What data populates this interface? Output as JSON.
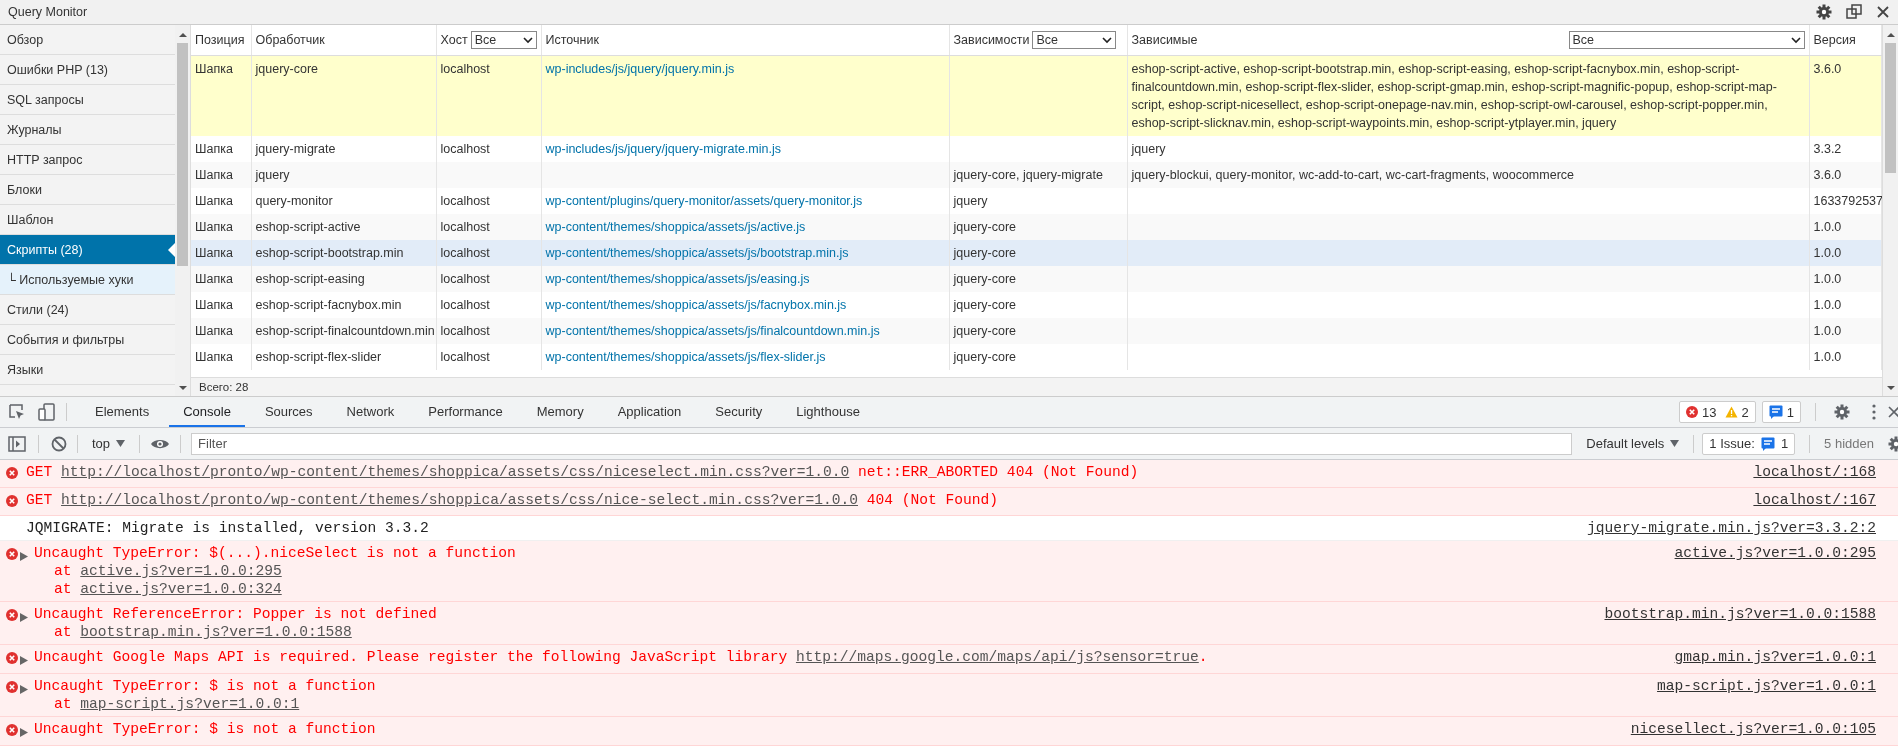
{
  "query_monitor": {
    "title": "Query Monitor",
    "sidebar": {
      "items": [
        {
          "label": "Обзор",
          "selected": false
        },
        {
          "label": "Ошибки PHP (13)",
          "selected": false
        },
        {
          "label": "SQL запросы",
          "selected": false
        },
        {
          "label": "Журналы",
          "selected": false
        },
        {
          "label": "HTTP запрос",
          "selected": false
        },
        {
          "label": "Блоки",
          "selected": false
        },
        {
          "label": "Шаблон",
          "selected": false
        },
        {
          "label": "Скрипты (28)",
          "selected": true,
          "children": [
            {
              "label": "└ Используемые хуки",
              "selected": false
            }
          ]
        },
        {
          "label": "Стили (24)",
          "selected": false
        },
        {
          "label": "События и фильтры",
          "selected": false
        },
        {
          "label": "Языки",
          "selected": false
        }
      ]
    },
    "table": {
      "columns": [
        {
          "label": "Позиция"
        },
        {
          "label": "Обработчик"
        },
        {
          "label": "Хост",
          "filter": "Все"
        },
        {
          "label": "Источник"
        },
        {
          "label": "Зависимости",
          "filter": "Все"
        },
        {
          "label": "Зависимые",
          "filter": "Все"
        },
        {
          "label": "Версия"
        }
      ],
      "rows": [
        {
          "selected": true,
          "hovered": false,
          "position": "Шапка",
          "handler": "jquery-core",
          "host": "localhost",
          "source": "wp-includes/js/jquery/jquery.min.js",
          "dependents": "eshop-script-active, eshop-script-bootstrap.min, eshop-script-easing, eshop-script-facnybox.min, eshop-script-finalcountdown.min, eshop-script-flex-slider, eshop-script-gmap.min, eshop-script-magnific-popup, eshop-script-map-script, eshop-script-nicesellect, eshop-script-onepage-nav.min, eshop-script-owl-carousel, eshop-script-popper.min, eshop-script-slicknav.min, eshop-script-waypoints.min, eshop-script-ytplayer.min, jquery",
          "version": "3.6.0"
        },
        {
          "selected": false,
          "hovered": false,
          "position": "Шапка",
          "handler": "jquery-migrate",
          "host": "localhost",
          "source": "wp-includes/js/jquery/jquery-migrate.min.js",
          "dependents": "jquery",
          "version": "3.3.2"
        },
        {
          "selected": false,
          "hovered": false,
          "position": "Шапка",
          "handler": "jquery",
          "dependencies": "jquery-core, jquery-migrate",
          "dependents": "jquery-blockui, query-monitor, wc-add-to-cart, wc-cart-fragments, woocommerce",
          "version": "3.6.0"
        },
        {
          "selected": false,
          "hovered": false,
          "position": "Шапка",
          "handler": "query-monitor",
          "host": "localhost",
          "source": "wp-content/plugins/query-monitor/assets/query-monitor.js",
          "dependencies": "jquery",
          "version": "1633792537"
        },
        {
          "selected": false,
          "hovered": false,
          "position": "Шапка",
          "handler": "eshop-script-active",
          "host": "localhost",
          "source": "wp-content/themes/shoppica/assets/js/active.js",
          "dependencies": "jquery-core",
          "version": "1.0.0"
        },
        {
          "selected": false,
          "hovered": true,
          "position": "Шапка",
          "handler": "eshop-script-bootstrap.min",
          "host": "localhost",
          "source": "wp-content/themes/shoppica/assets/js/bootstrap.min.js",
          "dependencies": "jquery-core",
          "version": "1.0.0"
        },
        {
          "selected": false,
          "hovered": false,
          "position": "Шапка",
          "handler": "eshop-script-easing",
          "host": "localhost",
          "source": "wp-content/themes/shoppica/assets/js/easing.js",
          "dependencies": "jquery-core",
          "version": "1.0.0"
        },
        {
          "selected": false,
          "hovered": false,
          "position": "Шапка",
          "handler": "eshop-script-facnybox.min",
          "host": "localhost",
          "source": "wp-content/themes/shoppica/assets/js/facnybox.min.js",
          "dependencies": "jquery-core",
          "version": "1.0.0"
        },
        {
          "selected": false,
          "hovered": false,
          "position": "Шапка",
          "handler": "eshop-script-finalcountdown.min",
          "host": "localhost",
          "source": "wp-content/themes/shoppica/assets/js/finalcountdown.min.js",
          "dependencies": "jquery-core",
          "version": "1.0.0"
        },
        {
          "selected": false,
          "hovered": false,
          "position": "Шапка",
          "handler": "eshop-script-flex-slider",
          "host": "localhost",
          "source": "wp-content/themes/shoppica/assets/js/flex-slider.js",
          "dependencies": "jquery-core",
          "version": "1.0.0"
        }
      ],
      "footer": "Всего: 28"
    }
  },
  "devtools": {
    "tabs": [
      {
        "label": "Elements",
        "selected": false
      },
      {
        "label": "Console",
        "selected": true
      },
      {
        "label": "Sources",
        "selected": false
      },
      {
        "label": "Network",
        "selected": false
      },
      {
        "label": "Performance",
        "selected": false
      },
      {
        "label": "Memory",
        "selected": false
      },
      {
        "label": "Application",
        "selected": false
      },
      {
        "label": "Security",
        "selected": false
      },
      {
        "label": "Lighthouse",
        "selected": false
      }
    ],
    "counters": {
      "errors": "13",
      "warnings": "2",
      "messages": "1"
    },
    "toolbar": {
      "context": "top",
      "filter_placeholder": "Filter",
      "levels": "Default levels",
      "issues_label": "1 Issue:",
      "issues_count": "1",
      "hidden": "5 hidden"
    },
    "messages": [
      {
        "kind": "error",
        "expandable": false,
        "parts": [
          {
            "text": "GET ",
            "link": false
          },
          {
            "text": "http://localhost/pronto/wp-content/themes/shoppica/assets/css/niceselect.min.css?ver=1.0.0",
            "link": true
          },
          {
            "text": " net::ERR_ABORTED 404 (Not Found)",
            "link": false
          }
        ],
        "source": "localhost/:168"
      },
      {
        "kind": "error",
        "expandable": false,
        "parts": [
          {
            "text": "GET ",
            "link": false
          },
          {
            "text": "http://localhost/pronto/wp-content/themes/shoppica/assets/css/nice-select.min.css?ver=1.0.0",
            "link": true
          },
          {
            "text": " 404 (Not Found)",
            "link": false
          }
        ],
        "source": "localhost/:167"
      },
      {
        "kind": "info",
        "expandable": false,
        "parts": [
          {
            "text": "JQMIGRATE: Migrate is installed, version 3.3.2",
            "link": false
          }
        ],
        "source": "jquery-migrate.min.js?ver=3.3.2:2"
      },
      {
        "kind": "error",
        "expandable": true,
        "parts": [
          {
            "text": "Uncaught TypeError: $(...).niceSelect is not a function",
            "link": false
          }
        ],
        "source": "active.js?ver=1.0.0:295",
        "stack": [
          {
            "prefix": "at",
            "link": "active.js?ver=1.0.0:295"
          },
          {
            "prefix": "at",
            "link": "active.js?ver=1.0.0:324"
          }
        ]
      },
      {
        "kind": "error",
        "expandable": true,
        "parts": [
          {
            "text": "Uncaught ReferenceError: Popper is not defined",
            "link": false
          }
        ],
        "source": "bootstrap.min.js?ver=1.0.0:1588",
        "stack": [
          {
            "prefix": "at",
            "link": "bootstrap.min.js?ver=1.0.0:1588"
          }
        ]
      },
      {
        "kind": "error",
        "expandable": true,
        "parts": [
          {
            "text": "Uncaught Google Maps API is required. Please register the following JavaScript library ",
            "link": false
          },
          {
            "text": "http://maps.google.com/maps/api/js?sensor=true",
            "link": true
          },
          {
            "text": ".",
            "link": false
          }
        ],
        "source": "gmap.min.js?ver=1.0.0:1"
      },
      {
        "kind": "error",
        "expandable": true,
        "parts": [
          {
            "text": "Uncaught TypeError: $ is not a function",
            "link": false
          }
        ],
        "source": "map-script.js?ver=1.0.0:1",
        "stack": [
          {
            "prefix": "at",
            "link": "map-script.js?ver=1.0.0:1"
          }
        ]
      },
      {
        "kind": "error",
        "expandable": true,
        "parts": [
          {
            "text": "Uncaught TypeError: $ is not a function",
            "link": false
          }
        ],
        "source": "nicesellect.js?ver=1.0.0:105"
      }
    ]
  }
}
